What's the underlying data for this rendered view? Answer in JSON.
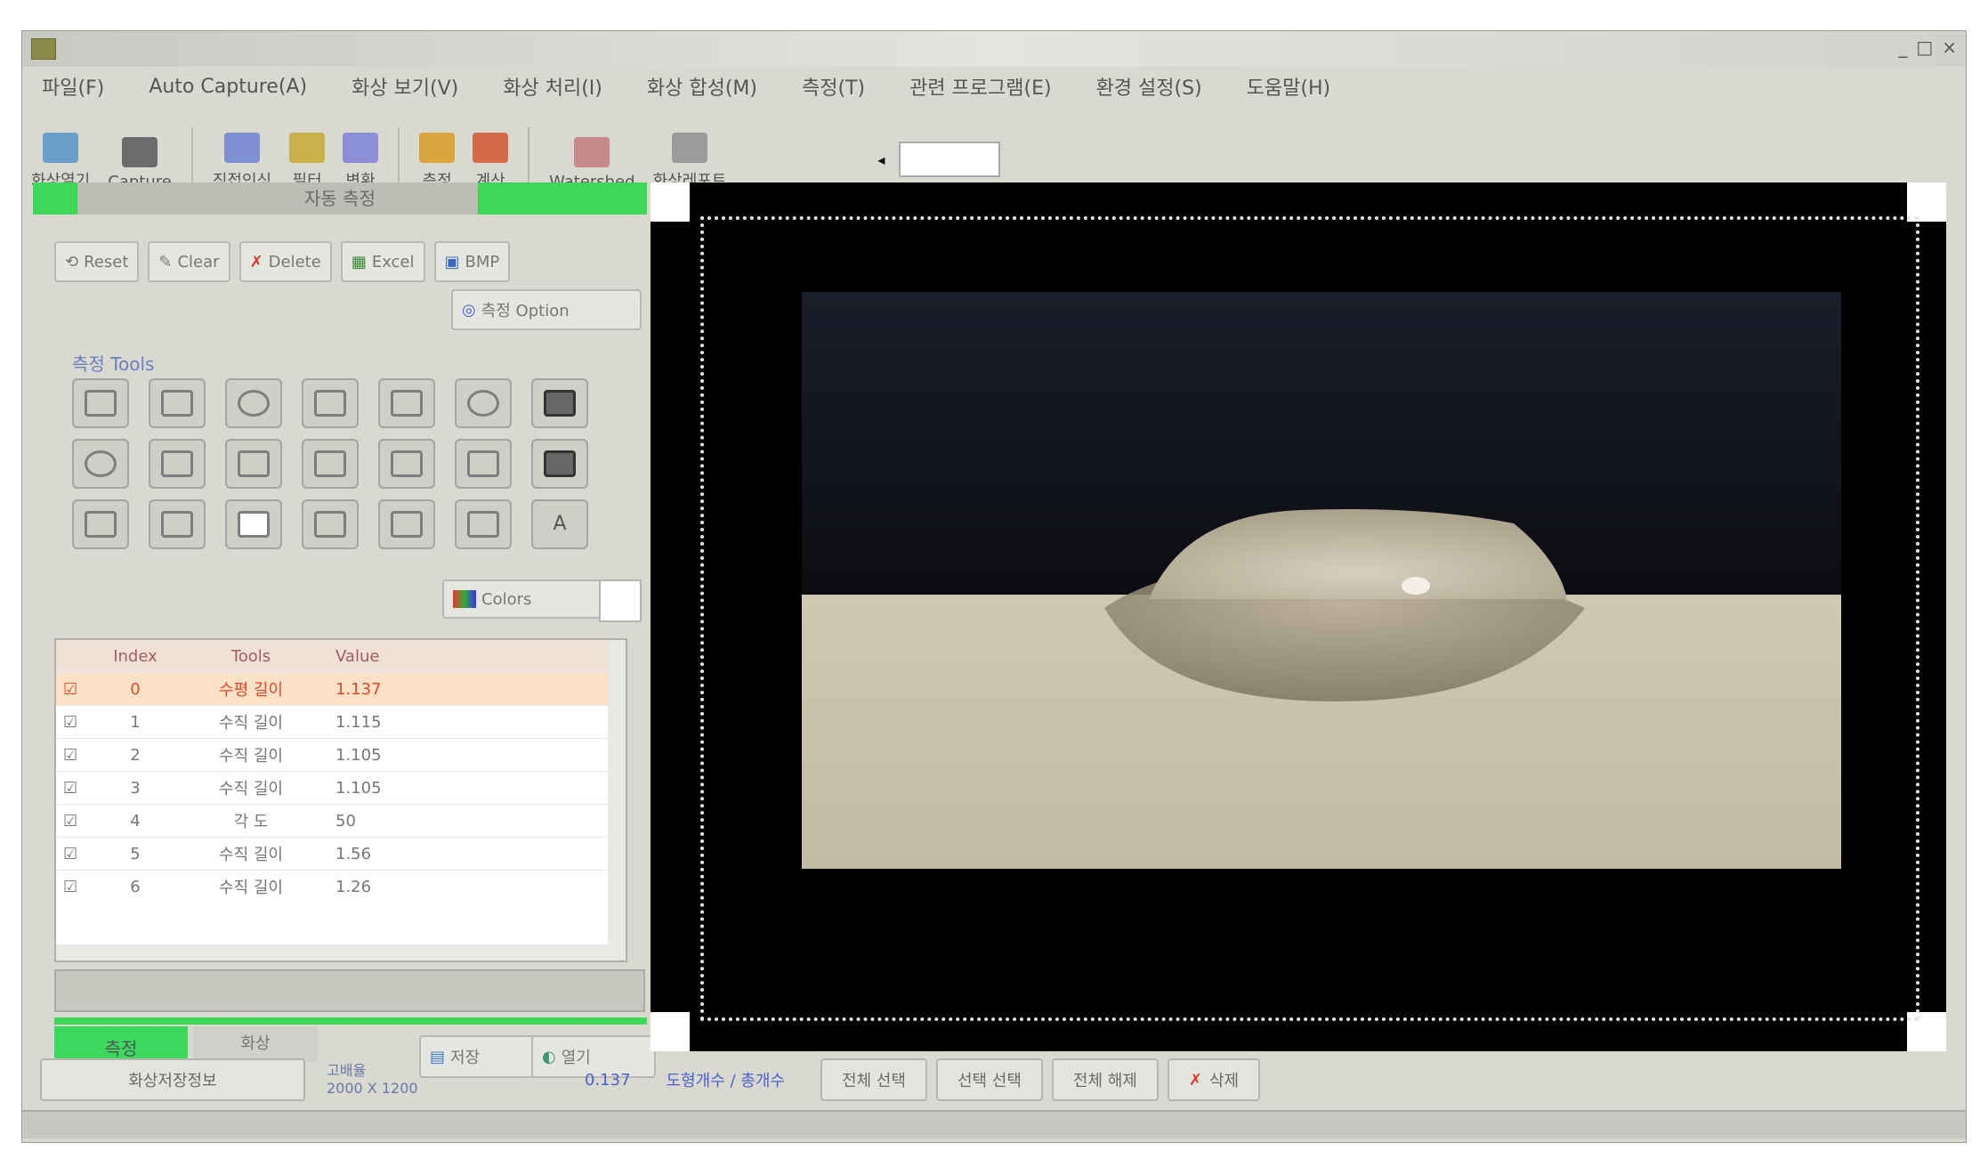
{
  "window": {
    "title": ""
  },
  "menu": [
    "파일(F)",
    "Auto Capture(A)",
    "화상 보기(V)",
    "화상 처리(I)",
    "화상 합성(M)",
    "측정(T)",
    "관련 프로그램(E)",
    "환경 설정(S)",
    "도움말(H)"
  ],
  "toolbar": {
    "buttons": [
      {
        "label": "화상열기",
        "icon": "open-image-icon"
      },
      {
        "label": "Capture",
        "icon": "camera-icon"
      },
      {
        "label": "직접인식",
        "icon": "measure-icon"
      },
      {
        "label": "필터",
        "icon": "filter-icon"
      },
      {
        "label": "변환",
        "icon": "convert-icon"
      },
      {
        "label": "측정",
        "icon": "chart-icon"
      },
      {
        "label": "계산",
        "icon": "calc-icon"
      },
      {
        "label": "Watershed",
        "icon": "watershed-icon"
      },
      {
        "label": "화상레포트",
        "icon": "report-icon"
      }
    ],
    "zoom": ""
  },
  "panel": {
    "title": "자동 측정",
    "buttons": [
      "Reset",
      "Clear",
      "Delete",
      "Excel",
      "BMP"
    ],
    "option_label": "측정 Option",
    "tools_label": "측정 Tools",
    "colors_label": "Colors"
  },
  "table": {
    "headers": [
      "Index",
      "Tools",
      "Value"
    ],
    "rows": [
      [
        "0",
        "수평 길이",
        "1.137"
      ],
      [
        "1",
        "수직 길이",
        "1.115"
      ],
      [
        "2",
        "수직 길이",
        "1.105"
      ],
      [
        "3",
        "수직 길이",
        "1.105"
      ],
      [
        "4",
        "각 도",
        "50"
      ],
      [
        "5",
        "수직 길이",
        "1.56"
      ],
      [
        "6",
        "수직 길이",
        "1.26"
      ]
    ]
  },
  "bottom_tabs": {
    "active": "측정",
    "inactive": "화상",
    "save": "저장",
    "load": "열기"
  },
  "status": {
    "file_btn": "화상저장정보",
    "info_line1": "고배율",
    "info_line2": "2000 X 1200",
    "scale": "0.137",
    "count_text": "도형개수 / 총개수",
    "btns": [
      "전체 선택",
      "선택 선택",
      "전체 해제",
      "삭제"
    ]
  },
  "colors": {
    "accent_green": "#3fd75a",
    "selected_row": "#fbe1c6",
    "selected_text": "#e04a2a"
  }
}
